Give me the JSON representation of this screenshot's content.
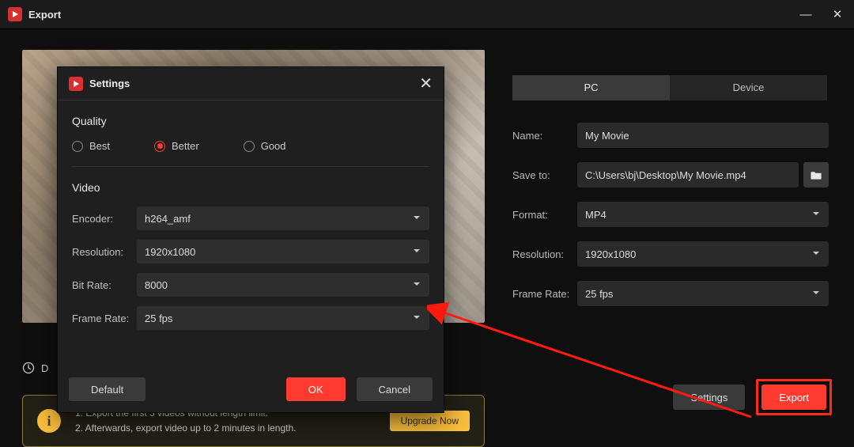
{
  "window": {
    "title": "Export"
  },
  "tabs": {
    "pc": "PC",
    "device": "Device"
  },
  "labels": {
    "name": "Name:",
    "save_to": "Save to:",
    "format": "Format:",
    "resolution": "Resolution:",
    "frame_rate": "Frame Rate:"
  },
  "values": {
    "name": "My Movie",
    "save_to": "C:\\Users\\bj\\Desktop\\My Movie.mp4",
    "format": "MP4",
    "resolution": "1920x1080",
    "frame_rate": "25 fps"
  },
  "duration_prefix": "D",
  "notice": {
    "line1": "1. Export the first 3 videos without length limit.",
    "line2": "2. Afterwards, export video up to 2 minutes in length.",
    "upgrade": "Upgrade Now"
  },
  "buttons": {
    "settings": "Settings",
    "export": "Export"
  },
  "modal": {
    "title": "Settings",
    "quality_title": "Quality",
    "radios": {
      "best": "Best",
      "better": "Better",
      "good": "Good"
    },
    "video_title": "Video",
    "labels": {
      "encoder": "Encoder:",
      "resolution": "Resolution:",
      "bitrate": "Bit Rate:",
      "framerate": "Frame Rate:"
    },
    "values": {
      "encoder": "h264_amf",
      "resolution": "1920x1080",
      "bitrate": "8000",
      "framerate": "25 fps"
    },
    "buttons": {
      "default": "Default",
      "ok": "OK",
      "cancel": "Cancel"
    }
  }
}
